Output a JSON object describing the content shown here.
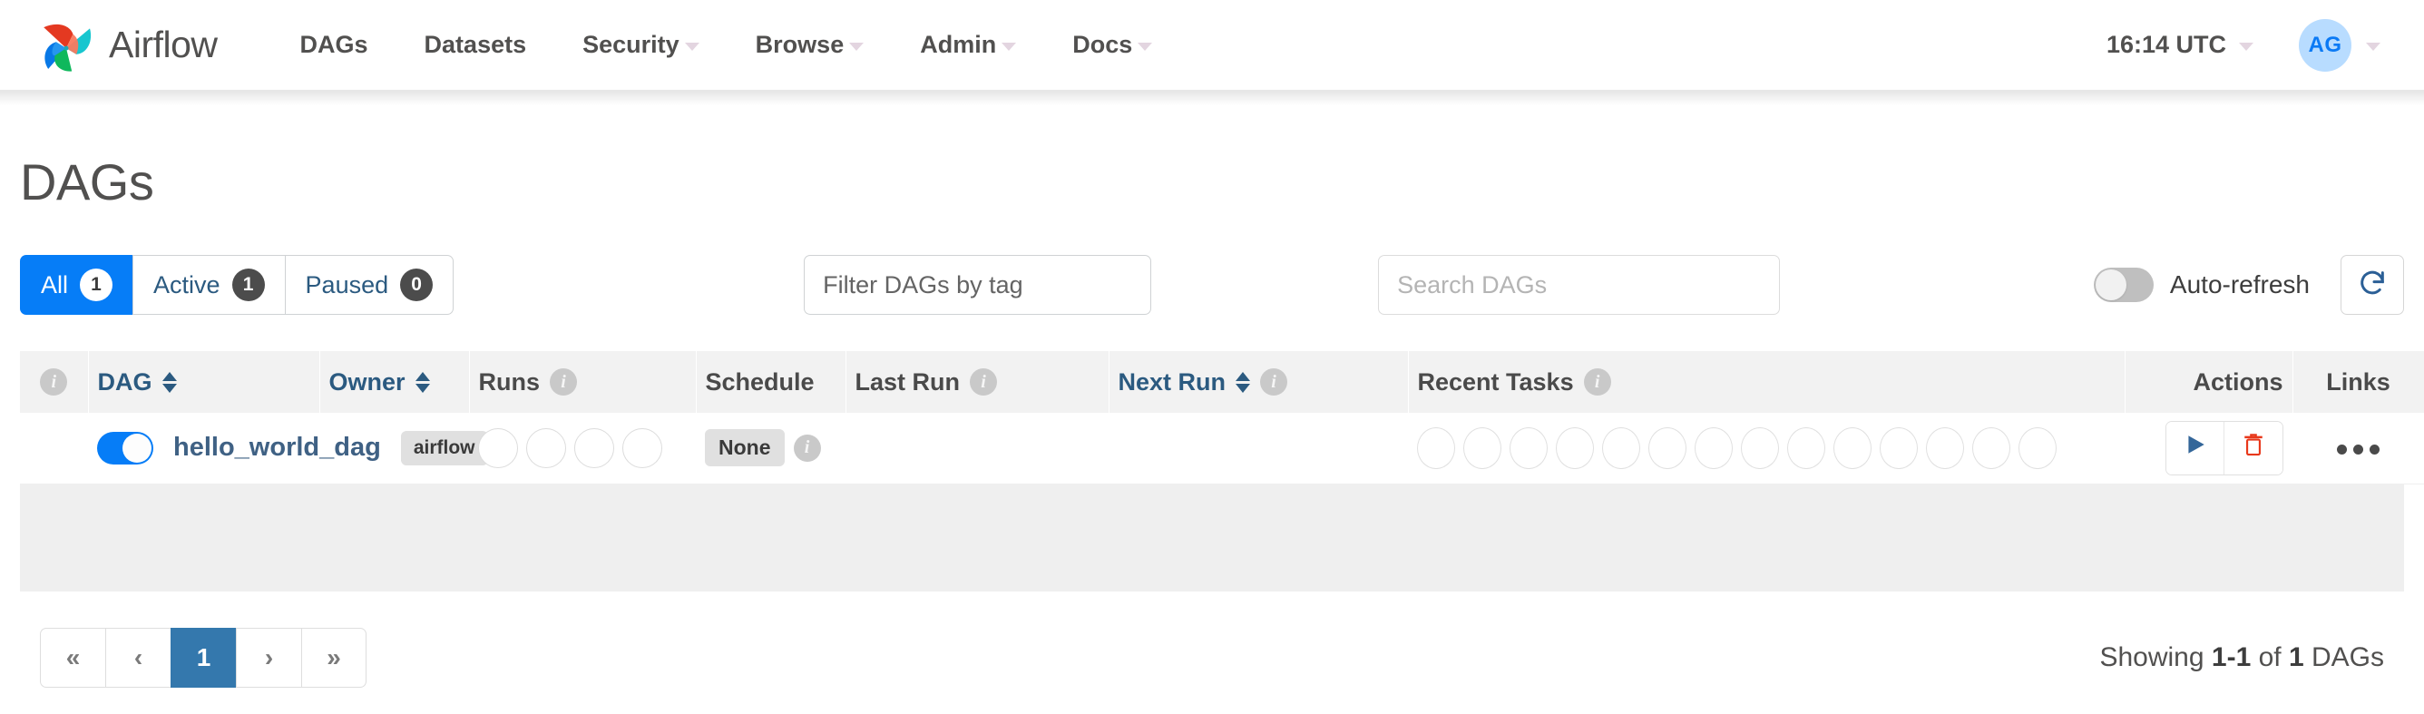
{
  "navbar": {
    "brand_label": "Airflow",
    "brand_logo_icon": "airflow-pinwheel-logo",
    "items": [
      {
        "label": "DAGs",
        "has_caret": false
      },
      {
        "label": "Datasets",
        "has_caret": false
      },
      {
        "label": "Security",
        "has_caret": true
      },
      {
        "label": "Browse",
        "has_caret": true
      },
      {
        "label": "Admin",
        "has_caret": true
      },
      {
        "label": "Docs",
        "has_caret": true
      }
    ],
    "clock_label": "16:14 UTC",
    "user_initials": "AG"
  },
  "page": {
    "title": "DAGs"
  },
  "filters": {
    "tabs": [
      {
        "label": "All",
        "count": "1",
        "active": true
      },
      {
        "label": "Active",
        "count": "1",
        "active": false
      },
      {
        "label": "Paused",
        "count": "0",
        "active": false
      }
    ],
    "tag_filter_placeholder": "Filter DAGs by tag",
    "tag_filter_value": "",
    "search_placeholder": "Search DAGs",
    "search_value": "",
    "auto_refresh_label": "Auto-refresh",
    "auto_refresh_on": false,
    "refresh_icon": "refresh-circular-arrow-icon"
  },
  "table": {
    "columns": {
      "info": "",
      "dag": "DAG",
      "owner": "Owner",
      "runs": "Runs",
      "schedule": "Schedule",
      "last_run": "Last Run",
      "next_run": "Next Run",
      "recent_tasks": "Recent Tasks",
      "actions": "Actions",
      "links": "Links"
    },
    "rows": [
      {
        "enabled": true,
        "dag_id": "hello_world_dag",
        "owner": "airflow",
        "runs_slots": 4,
        "schedule": "None",
        "last_run": "",
        "next_run": "",
        "recent_task_slots": 14,
        "trigger_icon": "play-triangle-icon",
        "delete_icon": "trash-can-icon",
        "links_icon": "ellipsis-horizontal-icon"
      }
    ]
  },
  "footer": {
    "pagination": [
      {
        "label": "«",
        "name": "first",
        "current": false
      },
      {
        "label": "‹",
        "name": "previous",
        "current": false
      },
      {
        "label": "1",
        "name": "page-1",
        "current": true
      },
      {
        "label": "›",
        "name": "next",
        "current": false
      },
      {
        "label": "»",
        "name": "last",
        "current": false
      }
    ],
    "showing_prefix": "Showing ",
    "showing_range": "1-1",
    "showing_mid": " of ",
    "showing_total": "1",
    "showing_suffix": " DAGs"
  },
  "colors": {
    "accent_blue": "#067df7",
    "link_blue": "#2b5a80",
    "pagination_active": "#3478ad",
    "delete_red": "#e8381b",
    "trigger_blue": "#336699",
    "header_bg": "#f2f2f2",
    "avatar_bg": "#b8dcff"
  }
}
